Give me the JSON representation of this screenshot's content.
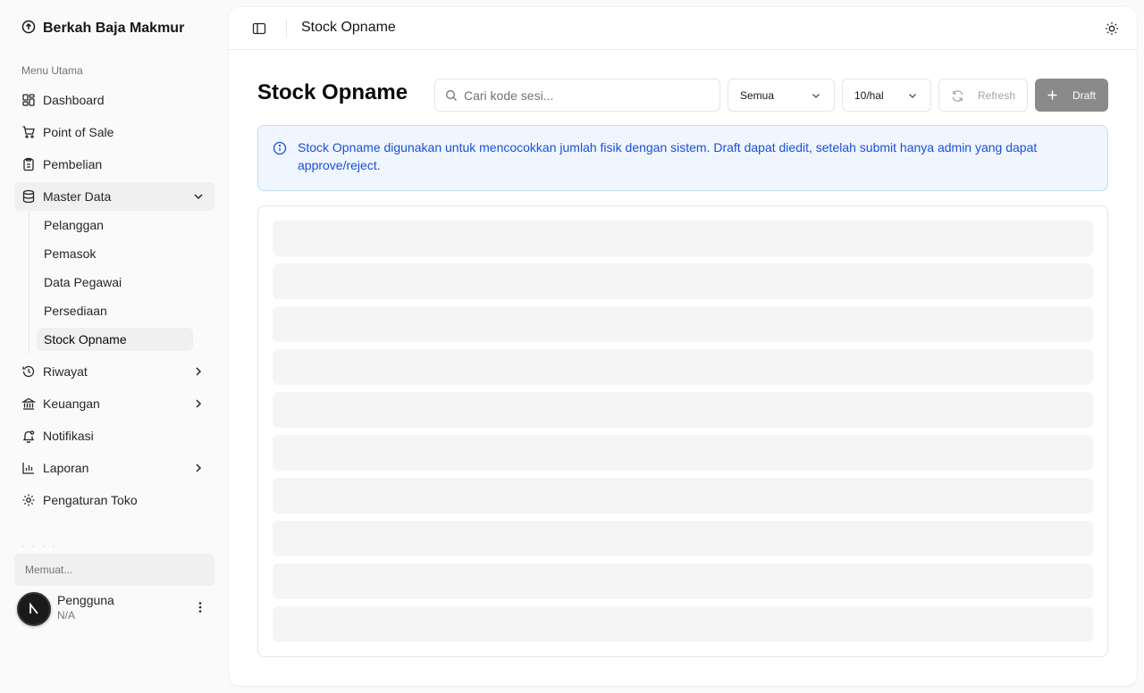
{
  "sidebar": {
    "brand": "Berkah Baja Makmur",
    "group_label": "Menu Utama",
    "items": [
      {
        "label": "Dashboard",
        "icon": "dashboard-icon"
      },
      {
        "label": "Point of Sale",
        "icon": "cart-icon"
      },
      {
        "label": "Pembelian",
        "icon": "clipboard-icon"
      },
      {
        "label": "Master Data",
        "icon": "database-icon",
        "expanded": true
      },
      {
        "label": "Riwayat",
        "icon": "history-icon"
      },
      {
        "label": "Keuangan",
        "icon": "bank-icon"
      },
      {
        "label": "Notifikasi",
        "icon": "bell-icon"
      },
      {
        "label": "Laporan",
        "icon": "bar-chart-icon"
      },
      {
        "label": "Pengaturan Toko",
        "icon": "gear-icon"
      }
    ],
    "sub_items": [
      {
        "label": "Pelanggan"
      },
      {
        "label": "Pemasok"
      },
      {
        "label": "Data Pegawai"
      },
      {
        "label": "Persediaan"
      },
      {
        "label": "Stock Opname",
        "active": true
      }
    ],
    "loading_text": "Memuat...",
    "user": {
      "name": "Pengguna",
      "role": "N/A"
    }
  },
  "topbar": {
    "title": "Stock Opname"
  },
  "page": {
    "title": "Stock Opname",
    "search_placeholder": "Cari kode sesi...",
    "status_filter": "Semua",
    "page_size": "10/hal",
    "refresh_label": "Refresh",
    "draft_label": "Draft",
    "info_text": "Stock Opname digunakan untuk mencocokkan jumlah fisik dengan sistem. Draft dapat diedit, setelah submit hanya admin yang dapat approve/reject."
  },
  "colors": {
    "accent_info": "#1d4ed8",
    "info_bg": "#eff6ff",
    "draft_button": "#8a8a8a"
  }
}
